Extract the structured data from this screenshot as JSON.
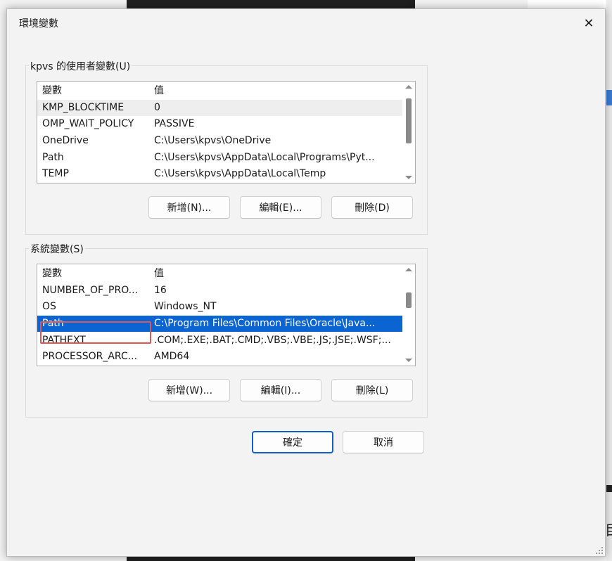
{
  "window": {
    "title": "環境變數",
    "close_glyph": "✕"
  },
  "user_vars": {
    "group_label": "kpvs 的使用者變數(U)",
    "columns": [
      "變數",
      "值"
    ],
    "rows": [
      {
        "name": "KMP_BLOCKTIME",
        "value": "0"
      },
      {
        "name": "OMP_WAIT_POLICY",
        "value": "PASSIVE"
      },
      {
        "name": "OneDrive",
        "value": "C:\\Users\\kpvs\\OneDrive"
      },
      {
        "name": "Path",
        "value": "C:\\Users\\kpvs\\AppData\\Local\\Programs\\Pyt..."
      },
      {
        "name": "TEMP",
        "value": "C:\\Users\\kpvs\\AppData\\Local\\Temp"
      }
    ],
    "buttons": {
      "new": "新增(N)...",
      "edit": "編輯(E)...",
      "delete": "刪除(D)"
    }
  },
  "system_vars": {
    "group_label": "系統變數(S)",
    "columns": [
      "變數",
      "值"
    ],
    "rows": [
      {
        "name": "NUMBER_OF_PRO...",
        "value": "16"
      },
      {
        "name": "OS",
        "value": "Windows_NT"
      },
      {
        "name": "Path",
        "value": "C:\\Program Files\\Common Files\\Oracle\\Java..."
      },
      {
        "name": "PATHEXT",
        "value": ".COM;.EXE;.BAT;.CMD;.VBS;.VBE;.JS;.JSE;.WSF;..."
      },
      {
        "name": "PROCESSOR_ARC...",
        "value": "AMD64"
      }
    ],
    "selected_row": "Path",
    "buttons": {
      "new": "新增(W)...",
      "edit": "編輯(I)...",
      "delete": "刪除(L)"
    }
  },
  "footer": {
    "ok": "確定",
    "cancel": "取消"
  },
  "colors": {
    "selection": "#0a64d2",
    "highlight_box": "#e05555",
    "primary_border": "#0f5fc4"
  },
  "background": {
    "right_edge_char": "目"
  }
}
